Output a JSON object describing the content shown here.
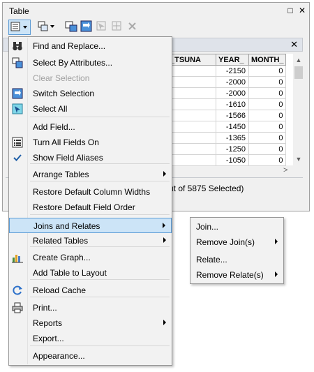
{
  "window": {
    "title": "Table",
    "restore_glyph": "□",
    "close_glyph": "✕"
  },
  "toolbar": {
    "options_icon": "table-options-icon",
    "related_icon": "related-tables-icon",
    "select_by_attributes_icon": "select-by-attributes-icon",
    "switch_selection_icon": "switch-selection-icon",
    "clear_selection_icon": "clear-selection-icon",
    "zoom_selected_icon": "zoom-to-selected-icon",
    "delete_selected_icon": "delete-selected-icon"
  },
  "tab": {
    "close_glyph": "✕"
  },
  "grid": {
    "columns": [
      "_TSUNA",
      "YEAR_",
      "MONTH_"
    ],
    "rows": [
      [
        "",
        "-2150",
        "0"
      ],
      [
        "",
        "-2000",
        "0"
      ],
      [
        "",
        "-2000",
        "0"
      ],
      [
        "",
        "-1610",
        "0"
      ],
      [
        "",
        "-1566",
        "0"
      ],
      [
        "",
        "-1450",
        "0"
      ],
      [
        "",
        "-1365",
        "0"
      ],
      [
        "",
        "-1250",
        "0"
      ],
      [
        "",
        "-1050",
        "0"
      ]
    ]
  },
  "status": {
    "text": "ut of 5875 Selected)"
  },
  "menu": {
    "items": [
      {
        "label": "Find and Replace...",
        "icon": "binoculars-icon"
      },
      {
        "label": "Select By Attributes...",
        "icon": "select-by-attributes-icon"
      },
      {
        "label": "Clear Selection",
        "icon": "",
        "disabled": true
      },
      {
        "label": "Switch Selection",
        "icon": "switch-selection-icon"
      },
      {
        "label": "Select All",
        "icon": "select-all-icon"
      },
      {
        "label": "Add Field...",
        "icon": ""
      },
      {
        "label": "Turn All Fields On",
        "icon": "list-icon"
      },
      {
        "label": "Show Field Aliases",
        "icon": "checkmark-icon"
      },
      {
        "label": "Arrange Tables",
        "icon": "",
        "submenu": true
      },
      {
        "label": "Restore Default Column Widths",
        "icon": ""
      },
      {
        "label": "Restore Default Field Order",
        "icon": ""
      },
      {
        "label": "Joins and Relates",
        "icon": "",
        "submenu": true,
        "highlight": true
      },
      {
        "label": "Related Tables",
        "icon": "",
        "submenu": true
      },
      {
        "label": "Create Graph...",
        "icon": "bar-chart-icon"
      },
      {
        "label": "Add Table to Layout",
        "icon": ""
      },
      {
        "label": "Reload Cache",
        "icon": "refresh-icon"
      },
      {
        "label": "Print...",
        "icon": "printer-icon"
      },
      {
        "label": "Reports",
        "icon": "",
        "submenu": true
      },
      {
        "label": "Export...",
        "icon": ""
      },
      {
        "label": "Appearance...",
        "icon": ""
      }
    ]
  },
  "submenu": {
    "items": [
      {
        "label": "Join...",
        "submenu": false
      },
      {
        "label": "Remove Join(s)",
        "submenu": true
      },
      {
        "label": "Relate...",
        "submenu": false
      },
      {
        "label": "Remove Relate(s)",
        "submenu": true
      }
    ]
  },
  "colors": {
    "highlight_bg": "#cce4f7",
    "highlight_border": "#5b9bd5",
    "menu_bg": "#f2f2f2"
  }
}
